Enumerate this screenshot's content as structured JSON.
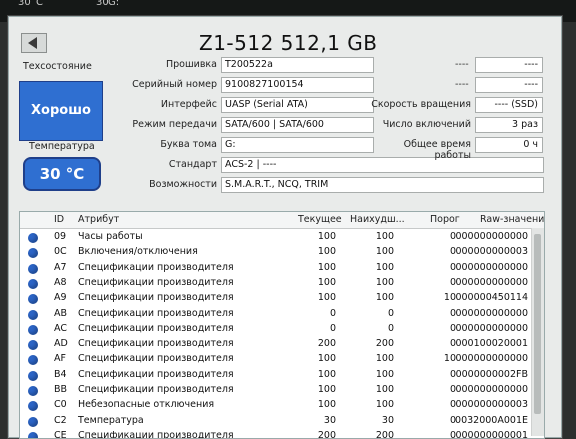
{
  "top": {
    "a": "30",
    "b": "C",
    "c": "30",
    "d": "G:"
  },
  "title": "Z1-512 512,1 GB",
  "health": {
    "label": "Техсостояние",
    "status": "Хорошо"
  },
  "temperature": {
    "label": "Температура",
    "value": "30 °C"
  },
  "info": {
    "firmware_label": "Прошивка",
    "firmware": "T200522a",
    "serial_label": "Серийный номер",
    "serial": "9100827100154",
    "interface_label": "Интерфейс",
    "interface": "UASP (Serial ATA)",
    "transfer_label": "Режим передачи",
    "transfer": "SATA/600 | SATA/600",
    "letter_label": "Буква тома",
    "letter": "G:",
    "standard_label": "Стандарт",
    "standard": "ACS-2 | ----",
    "features_label": "Возможности",
    "features": "S.M.A.R.T., NCQ, TRIM",
    "right_dash_1": "----",
    "right_dash_2": "----",
    "right_dash_3": "----",
    "right_dash_4": "----",
    "rotation_label": "Скорость вращения",
    "rotation": "---- (SSD)",
    "power_on_count_label": "Число включений",
    "power_on_count": "3 раз",
    "power_on_hours_label": "Общее время работы",
    "power_on_hours": "0 ч"
  },
  "table": {
    "headers": {
      "id": "ID",
      "attr": "Атрибут",
      "current": "Текущее",
      "worst": "Наихудш...",
      "threshold": "Порог",
      "raw": "Raw-значения"
    },
    "rows": [
      {
        "id": "09",
        "attr": "Часы работы",
        "cur": "100",
        "worst": "100",
        "thr": "0",
        "raw": "000000000000"
      },
      {
        "id": "0C",
        "attr": "Включения/отключения",
        "cur": "100",
        "worst": "100",
        "thr": "0",
        "raw": "000000000003"
      },
      {
        "id": "A7",
        "attr": "Спецификации производителя",
        "cur": "100",
        "worst": "100",
        "thr": "0",
        "raw": "000000000000"
      },
      {
        "id": "A8",
        "attr": "Спецификации производителя",
        "cur": "100",
        "worst": "100",
        "thr": "0",
        "raw": "000000000000"
      },
      {
        "id": "A9",
        "attr": "Спецификации производителя",
        "cur": "100",
        "worst": "100",
        "thr": "10",
        "raw": "000000450114"
      },
      {
        "id": "AB",
        "attr": "Спецификации производителя",
        "cur": "0",
        "worst": "0",
        "thr": "0",
        "raw": "000000000000"
      },
      {
        "id": "AC",
        "attr": "Спецификации производителя",
        "cur": "0",
        "worst": "0",
        "thr": "0",
        "raw": "000000000000"
      },
      {
        "id": "AD",
        "attr": "Спецификации производителя",
        "cur": "200",
        "worst": "200",
        "thr": "0",
        "raw": "000100020001"
      },
      {
        "id": "AF",
        "attr": "Спецификации производителя",
        "cur": "100",
        "worst": "100",
        "thr": "10",
        "raw": "000000000000"
      },
      {
        "id": "B4",
        "attr": "Спецификации производителя",
        "cur": "100",
        "worst": "100",
        "thr": "0",
        "raw": "0000000002FB"
      },
      {
        "id": "BB",
        "attr": "Спецификации производителя",
        "cur": "100",
        "worst": "100",
        "thr": "0",
        "raw": "000000000000"
      },
      {
        "id": "C0",
        "attr": "Небезопасные отключения",
        "cur": "100",
        "worst": "100",
        "thr": "0",
        "raw": "000000000003"
      },
      {
        "id": "C2",
        "attr": "Температура",
        "cur": "30",
        "worst": "30",
        "thr": "0",
        "raw": "0032000A001E"
      },
      {
        "id": "CE",
        "attr": "Спецификации производителя",
        "cur": "200",
        "worst": "200",
        "thr": "0",
        "raw": "000000000001"
      }
    ]
  }
}
